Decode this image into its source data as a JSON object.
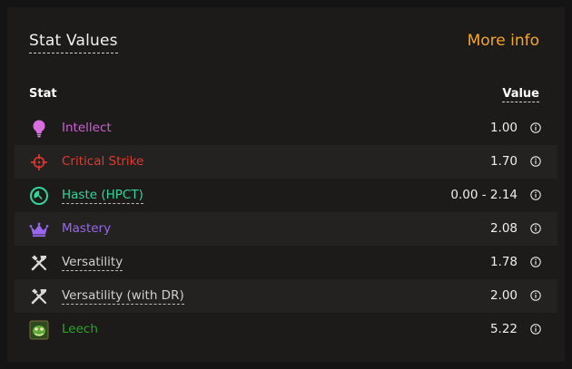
{
  "header": {
    "title": "Stat Values",
    "more_info": "More info"
  },
  "table": {
    "col_stat": "Stat",
    "col_value": "Value",
    "rows": [
      {
        "name": "Intellect",
        "value": "1.00",
        "color": "#cd5fd6",
        "icon": "lightbulb-icon"
      },
      {
        "name": "Critical Strike",
        "value": "1.70",
        "color": "#e03a2f",
        "icon": "crosshair-icon"
      },
      {
        "name": "Haste (HPCT)",
        "value": "0.00 - 2.14",
        "color": "#33d49a",
        "icon": "clock-icon"
      },
      {
        "name": "Mastery",
        "value": "2.08",
        "color": "#9966ee",
        "icon": "crown-icon"
      },
      {
        "name": "Versatility",
        "value": "1.78",
        "color": "#cfcfcf",
        "icon": "tools-icon"
      },
      {
        "name": "Versatility (with DR)",
        "value": "2.00",
        "color": "#cfcfcf",
        "icon": "tools-icon"
      },
      {
        "name": "Leech",
        "value": "5.22",
        "color": "#2aa52a",
        "icon": "leech-icon"
      }
    ]
  }
}
